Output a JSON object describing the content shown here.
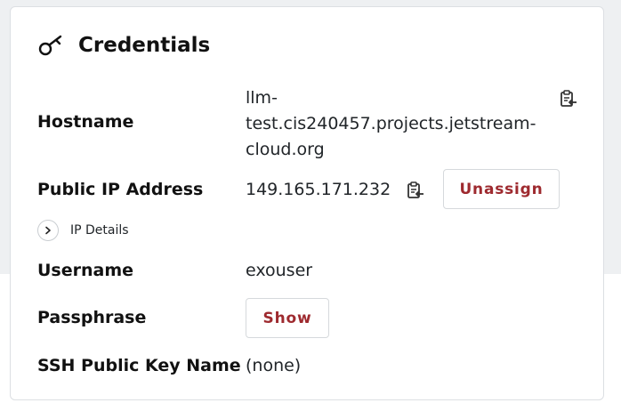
{
  "card": {
    "title": "Credentials",
    "title_icon": "key-icon"
  },
  "rows": {
    "hostname": {
      "label": "Hostname",
      "value_lines": [
        "llm-",
        "test.cis240457.projects.jetstream-",
        "cloud.org"
      ],
      "copy_icon": "copy-clipboard-icon"
    },
    "public_ip": {
      "label": "Public IP Address",
      "value": "149.165.171.232",
      "copy_icon": "copy-clipboard-icon",
      "button_label": "Unassign"
    },
    "ip_details": {
      "label": "IP Details",
      "icon": "chevron-right-icon"
    },
    "username": {
      "label": "Username",
      "value": "exouser"
    },
    "passphrase": {
      "label": "Passphrase",
      "button_label": "Show"
    },
    "ssh_key": {
      "label": "SSH Public Key Name",
      "value": "(none)"
    }
  },
  "colors": {
    "accent": "#9e2a2f",
    "border": "#dcdfe3",
    "text": "#212529"
  }
}
